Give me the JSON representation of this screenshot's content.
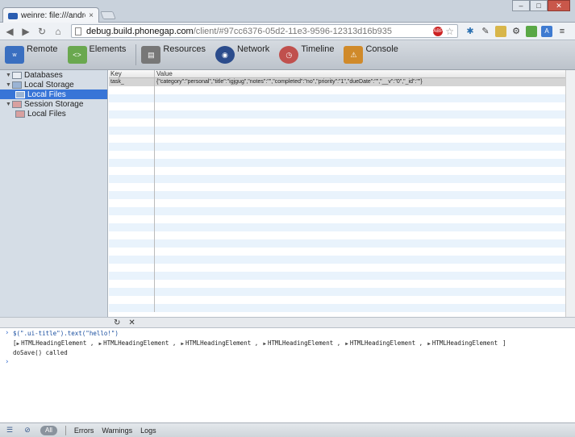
{
  "browser": {
    "tab_title": "weinre: file:///android_as",
    "tab_close": "×",
    "url_host": "debug.build.phonegap.com",
    "url_path": "/client/#97cc6376-05d2-11e3-9596-12313d16b935",
    "abp_label": "ABP",
    "window_min": "–",
    "window_max": "□",
    "window_close": "✕"
  },
  "panels": [
    {
      "label": "Remote",
      "icon": "weinre-logo-icon",
      "color": "#3a6fc0"
    },
    {
      "label": "Elements",
      "icon": "elements-icon",
      "color": "#6aa84f"
    },
    {
      "label": "Resources",
      "icon": "resources-icon",
      "color": "#777777"
    },
    {
      "label": "Network",
      "icon": "network-icon",
      "color": "#2b4c8c"
    },
    {
      "label": "Timeline",
      "icon": "timeline-icon",
      "color": "#c0504d"
    },
    {
      "label": "Console",
      "icon": "console-icon",
      "color": "#d08a2a"
    }
  ],
  "sidebar": {
    "items": [
      {
        "label": "Databases",
        "level": 0,
        "expanded": true
      },
      {
        "label": "Local Storage",
        "level": 0,
        "expanded": true
      },
      {
        "label": "Local Files",
        "level": 1,
        "selected": true
      },
      {
        "label": "Session Storage",
        "level": 0,
        "expanded": true
      },
      {
        "label": "Local Files",
        "level": 1,
        "selected": false
      }
    ]
  },
  "grid": {
    "headers": {
      "key": "Key",
      "value": "Value"
    },
    "rows": [
      {
        "key": "task_",
        "value": "{\"category\":\"personal\",\"title\":\"igjgug\",\"notes\":\"\",\"completed\":\"no\",\"priority\":\"1\",\"dueDate\":\"\",\"__v\":\"0\",\"_id\":\"\"}"
      }
    ]
  },
  "grid_toolbar": {
    "refresh": "↻",
    "delete": "✕"
  },
  "console": {
    "command": "$(\".ui-title\").text(\"hello!\")",
    "result_open": "[",
    "result_close": "]",
    "elements": [
      "HTMLHeadingElement",
      "HTMLHeadingElement",
      "HTMLHeadingElement",
      "HTMLHeadingElement",
      "HTMLHeadingElement",
      "HTMLHeadingElement"
    ],
    "log_line": "doSave() called",
    "prompt": "›"
  },
  "statusbar": {
    "all": "All",
    "errors": "Errors",
    "warnings": "Warnings",
    "logs": "Logs"
  }
}
